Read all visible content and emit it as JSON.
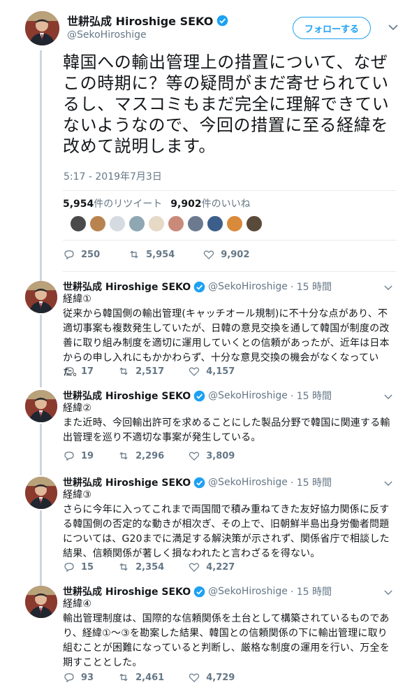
{
  "main": {
    "name": "世耕弘成 Hiroshige SEKO",
    "handle": "@SekoHiroshige",
    "follow_label": "フォローする",
    "text": "韓国への輸出管理上の措置について、なぜこの時期に？等の疑問がまだ寄せられているし、マスコミもまだ完全に理解できていないようなので、今回の措置に至る経緯を改めて説明します。",
    "timestamp": "5:17 - 2019年7月3日",
    "retweet_count": "5,954",
    "retweet_label": "件のリツイート",
    "like_count": "9,902",
    "like_label": "件のいいね",
    "replies": "250",
    "retweets": "5,954",
    "likes": "9,902"
  },
  "replies": [
    {
      "name": "世耕弘成 Hiroshige SEKO",
      "handle": "@SekoHiroshige",
      "time": "· 15 時間",
      "text": "経緯①\n従来から韓国側の輸出管理(キャッチオール規制)に不十分な点があり、不適切事案も複数発生していたが、日韓の意見交換を通して韓国が制度の改善に取り組み制度を適切に運用していくとの信頼があったが、近年は日本からの申し入れにもかかわらず、十分な意見交換の機会がなくなっていた。",
      "replies": "17",
      "retweets": "2,517",
      "likes": "4,157"
    },
    {
      "name": "世耕弘成 Hiroshige SEKO",
      "handle": "@SekoHiroshige",
      "time": "· 15 時間",
      "text": "経緯②\nまた近時、今回輸出許可を求めることにした製品分野で韓国に関連する輸出管理を巡り不適切な事案が発生している。",
      "replies": "19",
      "retweets": "2,296",
      "likes": "3,809"
    },
    {
      "name": "世耕弘成 Hiroshige SEKO",
      "handle": "@SekoHiroshige",
      "time": "· 15 時間",
      "text": "経緯③\nさらに今年に入ってこれまで両国間で積み重ねてきた友好協力関係に反する韓国側の否定的な動きが相次ぎ、その上で、旧朝鮮半島出身労働者問題については、G20までに満足する解決策が示されず、関係省庁で相談した結果、信頼関係が著しく損なわれたと言わざるを得ない。",
      "replies": "15",
      "retweets": "2,354",
      "likes": "4,227"
    },
    {
      "name": "世耕弘成 Hiroshige SEKO",
      "handle": "@SekoHiroshige",
      "time": "· 15 時間",
      "text": "経緯④\n輸出管理制度は、国際的な信頼関係を土台として構築されているものであり、経緯①〜③を勘案した結果、韓国との信頼関係の下に輸出管理に取り組むことが困難になっていると判断し、厳格な制度の運用を行い、万全を期すこととした。",
      "replies": "93",
      "retweets": "2,461",
      "likes": "4,729"
    }
  ],
  "colors": {
    "accent": "#1da1f2",
    "muted": "#657786",
    "text": "#14171a"
  },
  "icons": [
    "verified-badge-icon",
    "chevron-down-icon",
    "reply-icon",
    "retweet-icon",
    "like-icon"
  ]
}
